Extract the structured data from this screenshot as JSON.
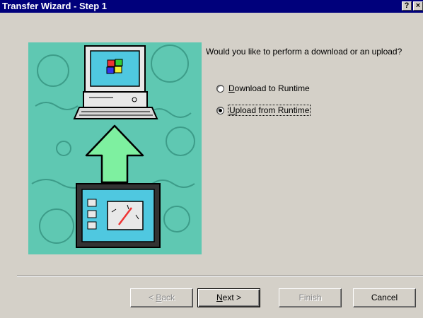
{
  "window": {
    "title": "Transfer Wizard - Step 1",
    "help_glyph": "?",
    "close_glyph": "×"
  },
  "content": {
    "question": "Would you like to perform a download or an upload?",
    "options": [
      {
        "accel": "D",
        "rest": "ownload to Runtime",
        "selected": false
      },
      {
        "accel": "U",
        "rest": "pload from Runtime",
        "selected": true
      }
    ]
  },
  "buttons": {
    "back": {
      "pre": "< ",
      "accel": "B",
      "rest": "ack",
      "enabled": false
    },
    "next": {
      "accel": "N",
      "rest": "ext >",
      "enabled": true
    },
    "finish": {
      "label": "Finish",
      "enabled": false
    },
    "cancel": {
      "label": "Cancel",
      "enabled": true
    }
  },
  "colors": {
    "title_bar": "#00007b",
    "dialog_face": "#d4d0c8",
    "illustration_bg": "#5fc8b2",
    "arrow": "#7ef0a0"
  },
  "icons": [
    "help-icon",
    "close-icon",
    "computer-icon",
    "upload-arrow-icon",
    "runtime-panel-icon"
  ]
}
